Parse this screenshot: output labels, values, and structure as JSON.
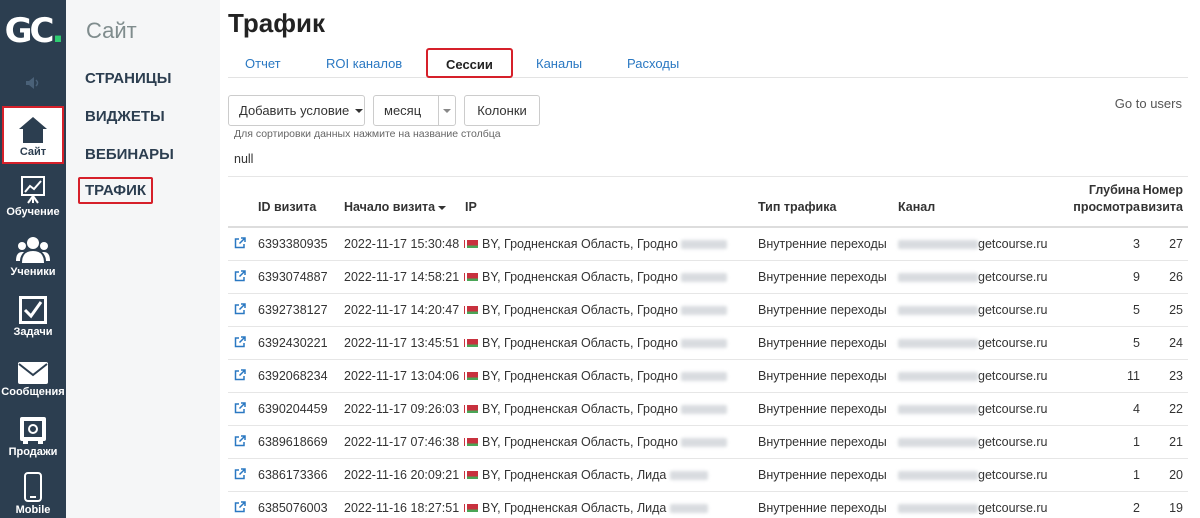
{
  "sidebar": {
    "logo": "GC",
    "logo_dot": ".",
    "items": [
      {
        "label": "Сайт",
        "icon": "home-icon"
      },
      {
        "label": "Обучение",
        "icon": "chart-board-icon"
      },
      {
        "label": "Ученики",
        "icon": "users-icon"
      },
      {
        "label": "Задачи",
        "icon": "checkbox-icon"
      },
      {
        "label": "Сообщения",
        "icon": "envelope-icon"
      },
      {
        "label": "Продажи",
        "icon": "safe-icon"
      },
      {
        "label": "Mobile",
        "icon": "phone-icon"
      }
    ]
  },
  "subnav": {
    "title": "Сайт",
    "items": [
      "СТРАНИЦЫ",
      "ВИДЖЕТЫ",
      "ВЕБИНАРЫ",
      "ТРАФИК"
    ]
  },
  "page": {
    "title": "Трафик",
    "tabs": [
      "Отчет",
      "ROI каналов",
      "Сессии",
      "Каналы",
      "Расходы"
    ],
    "active_tab": "Сессии",
    "add_condition": "Добавить условие",
    "period_value": "месяц",
    "columns_button": "Колонки",
    "go_users": "Go to users",
    "sort_hint": "Для сортировки данных нажмите на название столбца",
    "null_text": "null"
  },
  "table": {
    "headers": {
      "id": "ID визита",
      "start": "Начало визита",
      "ip": "IP",
      "type": "Тип трафика",
      "channel": "Канал",
      "depth_1": "Глубина",
      "depth_2": "просмотра",
      "num_1": "Номер",
      "num_2": "визита"
    },
    "rows": [
      {
        "id": "6393380935",
        "start": "2022-11-17 15:30:48",
        "ip": "BY, Гродненская Область, Гродно",
        "type": "Внутренние переходы",
        "channel": "getcourse.ru",
        "depth": "3",
        "num": "27"
      },
      {
        "id": "6393074887",
        "start": "2022-11-17 14:58:21",
        "ip": "BY, Гродненская Область, Гродно",
        "type": "Внутренние переходы",
        "channel": "getcourse.ru",
        "depth": "9",
        "num": "26"
      },
      {
        "id": "6392738127",
        "start": "2022-11-17 14:20:47",
        "ip": "BY, Гродненская Область, Гродно",
        "type": "Внутренние переходы",
        "channel": "getcourse.ru",
        "depth": "5",
        "num": "25"
      },
      {
        "id": "6392430221",
        "start": "2022-11-17 13:45:51",
        "ip": "BY, Гродненская Область, Гродно",
        "type": "Внутренние переходы",
        "channel": "getcourse.ru",
        "depth": "5",
        "num": "24"
      },
      {
        "id": "6392068234",
        "start": "2022-11-17 13:04:06",
        "ip": "BY, Гродненская Область, Гродно",
        "type": "Внутренние переходы",
        "channel": "getcourse.ru",
        "depth": "11",
        "num": "23"
      },
      {
        "id": "6390204459",
        "start": "2022-11-17 09:26:03",
        "ip": "BY, Гродненская Область, Гродно",
        "type": "Внутренние переходы",
        "channel": "getcourse.ru",
        "depth": "4",
        "num": "22"
      },
      {
        "id": "6389618669",
        "start": "2022-11-17 07:46:38",
        "ip": "BY, Гродненская Область, Гродно",
        "type": "Внутренние переходы",
        "channel": "getcourse.ru",
        "depth": "1",
        "num": "21"
      },
      {
        "id": "6386173366",
        "start": "2022-11-16 20:09:21",
        "ip": "BY, Гродненская Область, Лида",
        "type": "Внутренние переходы",
        "channel": "getcourse.ru",
        "depth": "1",
        "num": "20"
      },
      {
        "id": "6385076003",
        "start": "2022-11-16 18:27:51",
        "ip": "BY, Гродненская Область, Лида",
        "type": "Внутренние переходы",
        "channel": "getcourse.ru",
        "depth": "2",
        "num": "19"
      }
    ]
  }
}
